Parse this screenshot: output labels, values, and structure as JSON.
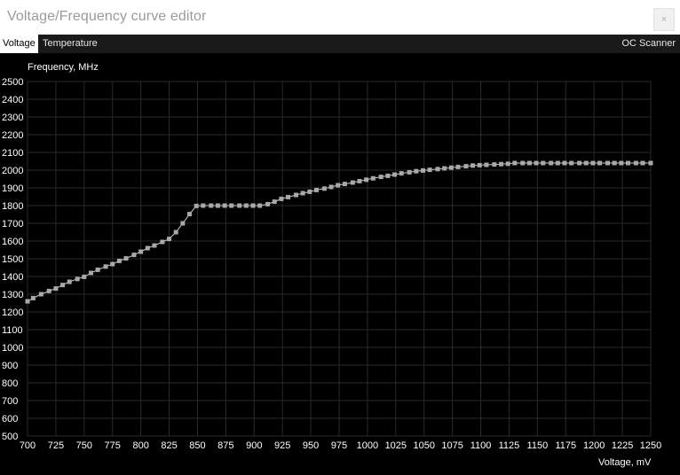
{
  "window": {
    "title": "Voltage/Frequency curve editor",
    "close_label": "×"
  },
  "tabs": [
    {
      "label": "Voltage",
      "active": true
    },
    {
      "label": "Temperature",
      "active": false
    }
  ],
  "oc_scanner_label": "OC Scanner",
  "colors": {
    "background": "#000000",
    "grid": "#2a2a2a",
    "curve": "#c8c8c8",
    "point": "#a9a9a9",
    "axis_text": "#ffffff"
  },
  "chart_data": {
    "type": "line",
    "ylabel": "Frequency, MHz",
    "xlabel": "Voltage, mV",
    "xlim": [
      700,
      1250
    ],
    "ylim": [
      500,
      2500
    ],
    "x_ticks": [
      700,
      725,
      750,
      775,
      800,
      825,
      850,
      875,
      900,
      925,
      950,
      975,
      1000,
      1025,
      1050,
      1075,
      1100,
      1125,
      1150,
      1175,
      1200,
      1225,
      1250
    ],
    "y_ticks": [
      500,
      600,
      700,
      800,
      900,
      1000,
      1100,
      1200,
      1300,
      1400,
      1500,
      1600,
      1700,
      1800,
      1900,
      2000,
      2100,
      2200,
      2300,
      2400,
      2500
    ],
    "grid": true,
    "series": [
      {
        "points": [
          [
            700,
            1260
          ],
          [
            705,
            1278
          ],
          [
            712,
            1300
          ],
          [
            719,
            1318
          ],
          [
            725,
            1332
          ],
          [
            731,
            1352
          ],
          [
            737,
            1370
          ],
          [
            744,
            1386
          ],
          [
            750,
            1398
          ],
          [
            756,
            1420
          ],
          [
            762,
            1438
          ],
          [
            769,
            1456
          ],
          [
            775,
            1470
          ],
          [
            781,
            1488
          ],
          [
            787,
            1502
          ],
          [
            794,
            1522
          ],
          [
            800,
            1540
          ],
          [
            806,
            1560
          ],
          [
            812,
            1575
          ],
          [
            819,
            1595
          ],
          [
            825,
            1612
          ],
          [
            831,
            1650
          ],
          [
            837,
            1700
          ],
          [
            843,
            1752
          ],
          [
            849,
            1798
          ],
          [
            855,
            1800
          ],
          [
            862,
            1800
          ],
          [
            868,
            1800
          ],
          [
            874,
            1800
          ],
          [
            880,
            1800
          ],
          [
            887,
            1800
          ],
          [
            893,
            1800
          ],
          [
            899,
            1800
          ],
          [
            905,
            1800
          ],
          [
            912,
            1808
          ],
          [
            918,
            1822
          ],
          [
            924,
            1838
          ],
          [
            930,
            1848
          ],
          [
            937,
            1860
          ],
          [
            943,
            1870
          ],
          [
            949,
            1878
          ],
          [
            955,
            1888
          ],
          [
            962,
            1896
          ],
          [
            968,
            1905
          ],
          [
            974,
            1915
          ],
          [
            980,
            1922
          ],
          [
            987,
            1930
          ],
          [
            993,
            1938
          ],
          [
            999,
            1946
          ],
          [
            1005,
            1954
          ],
          [
            1012,
            1962
          ],
          [
            1018,
            1968
          ],
          [
            1024,
            1975
          ],
          [
            1030,
            1982
          ],
          [
            1037,
            1988
          ],
          [
            1043,
            1994
          ],
          [
            1049,
            1998
          ],
          [
            1055,
            2002
          ],
          [
            1062,
            2006
          ],
          [
            1068,
            2010
          ],
          [
            1074,
            2014
          ],
          [
            1080,
            2018
          ],
          [
            1087,
            2022
          ],
          [
            1093,
            2026
          ],
          [
            1099,
            2028
          ],
          [
            1105,
            2030
          ],
          [
            1112,
            2032
          ],
          [
            1118,
            2034
          ],
          [
            1124,
            2036
          ],
          [
            1130,
            2040
          ],
          [
            1137,
            2040
          ],
          [
            1143,
            2040
          ],
          [
            1149,
            2040
          ],
          [
            1155,
            2040
          ],
          [
            1162,
            2040
          ],
          [
            1168,
            2040
          ],
          [
            1174,
            2040
          ],
          [
            1180,
            2040
          ],
          [
            1187,
            2040
          ],
          [
            1193,
            2040
          ],
          [
            1199,
            2040
          ],
          [
            1205,
            2040
          ],
          [
            1212,
            2040
          ],
          [
            1218,
            2040
          ],
          [
            1224,
            2040
          ],
          [
            1230,
            2040
          ],
          [
            1237,
            2040
          ],
          [
            1243,
            2040
          ],
          [
            1250,
            2040
          ]
        ]
      }
    ]
  }
}
